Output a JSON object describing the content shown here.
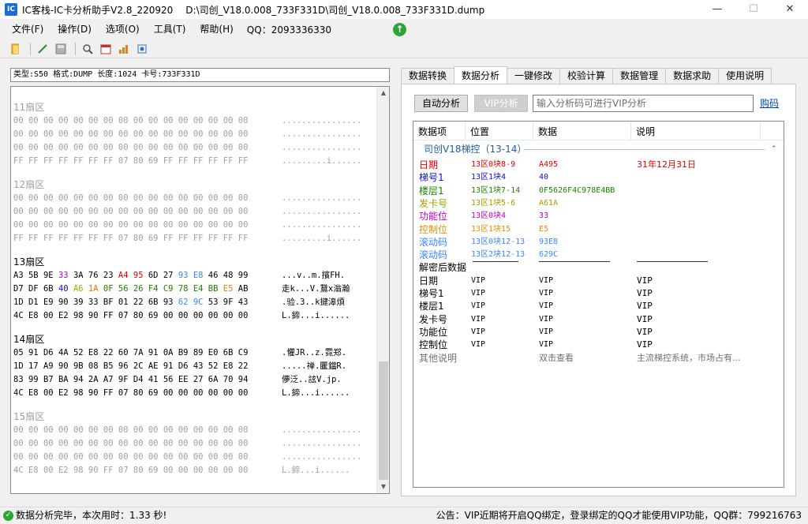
{
  "window": {
    "app_title": "IC客栈-IC卡分析助手V2.8_220920",
    "file_path": "D:\\司创_V18.0.008_733F331D\\司创_V18.0.008_733F331D.dump",
    "minimize": "—",
    "maximize": "☐",
    "close": "✕"
  },
  "menu": {
    "file": "文件(F)",
    "operate": "操作(D)",
    "options": "选项(O)",
    "tools": "工具(T)",
    "help": "帮助(H)",
    "qq": "QQ：2093336330"
  },
  "left": {
    "info": "类型:S50 格式:DUMP 长度:1024 卡号:733F331D",
    "sectors": [
      {
        "title": "11扇区",
        "grey": true,
        "rows": [
          {
            "bytes": [
              "00",
              "00",
              "00",
              "00",
              "00",
              "00",
              "00",
              "00",
              "00",
              "00",
              "00",
              "00",
              "00",
              "00",
              "00",
              "00"
            ],
            "ascii": "................"
          },
          {
            "bytes": [
              "00",
              "00",
              "00",
              "00",
              "00",
              "00",
              "00",
              "00",
              "00",
              "00",
              "00",
              "00",
              "00",
              "00",
              "00",
              "00"
            ],
            "ascii": "................"
          },
          {
            "bytes": [
              "00",
              "00",
              "00",
              "00",
              "00",
              "00",
              "00",
              "00",
              "00",
              "00",
              "00",
              "00",
              "00",
              "00",
              "00",
              "00"
            ],
            "ascii": "................"
          },
          {
            "bytes": [
              "FF",
              "FF",
              "FF",
              "FF",
              "FF",
              "FF",
              "FF",
              "07",
              "80",
              "69",
              "FF",
              "FF",
              "FF",
              "FF",
              "FF",
              "FF"
            ],
            "ascii": ".........i......"
          }
        ]
      },
      {
        "title": "12扇区",
        "grey": true,
        "rows": [
          {
            "bytes": [
              "00",
              "00",
              "00",
              "00",
              "00",
              "00",
              "00",
              "00",
              "00",
              "00",
              "00",
              "00",
              "00",
              "00",
              "00",
              "00"
            ],
            "ascii": "................"
          },
          {
            "bytes": [
              "00",
              "00",
              "00",
              "00",
              "00",
              "00",
              "00",
              "00",
              "00",
              "00",
              "00",
              "00",
              "00",
              "00",
              "00",
              "00"
            ],
            "ascii": "................"
          },
          {
            "bytes": [
              "00",
              "00",
              "00",
              "00",
              "00",
              "00",
              "00",
              "00",
              "00",
              "00",
              "00",
              "00",
              "00",
              "00",
              "00",
              "00"
            ],
            "ascii": "................"
          },
          {
            "bytes": [
              "FF",
              "FF",
              "FF",
              "FF",
              "FF",
              "FF",
              "FF",
              "07",
              "80",
              "69",
              "FF",
              "FF",
              "FF",
              "FF",
              "FF",
              "FF"
            ],
            "ascii": ".........i......"
          }
        ]
      },
      {
        "title": "13扇区",
        "grey": false,
        "rows": [
          {
            "bytes": [
              "A3",
              "5B",
              "9E",
              "33",
              "3A",
              "76",
              "23",
              "A4",
              "95",
              "6D",
              "27",
              "93",
              "E8",
              "46",
              "48",
              "99"
            ],
            "colors": [
              "",
              "",
              "",
              "#c000c0",
              "",
              "",
              "",
              "#e00000",
              "#e00000",
              "",
              "",
              "#3a86ff",
              "#3a86ff",
              "",
              "",
              ""
            ],
            "ascii": "...v..m.擯FH."
          },
          {
            "bytes": [
              "D7",
              "DF",
              "6B",
              "40",
              "A6",
              "1A",
              "0F",
              "56",
              "26",
              "F4",
              "C9",
              "78",
              "E4",
              "BB",
              "E5",
              "AB"
            ],
            "colors": [
              "",
              "",
              "",
              "#1010d0",
              "#a8a800",
              "#e08000",
              "#208000",
              "#208000",
              "#208000",
              "#208000",
              "#208000",
              "#208000",
              "#208000",
              "#208000",
              "#e08000",
              ""
            ],
            "ascii": "走k...V.鵞x滃瀚"
          },
          {
            "bytes": [
              "1D",
              "D1",
              "E9",
              "90",
              "39",
              "33",
              "BF",
              "01",
              "22",
              "6B",
              "93",
              "62",
              "9C",
              "53",
              "9F",
              "43"
            ],
            "colors": [
              "",
              "",
              "",
              "",
              "",
              "",
              "",
              "",
              "",
              "",
              "",
              "#3a86ff",
              "#3a86ff",
              "",
              "",
              ""
            ],
            "ascii": ".验.3..k揵滜煩"
          },
          {
            "bytes": [
              "4C",
              "E8",
              "00",
              "E2",
              "98",
              "90",
              "FF",
              "07",
              "80",
              "69",
              "00",
              "00",
              "00",
              "00",
              "00",
              "00"
            ],
            "ascii": "L.鍗...i......"
          }
        ]
      },
      {
        "title": "14扇区",
        "grey": false,
        "rows": [
          {
            "bytes": [
              "05",
              "91",
              "D6",
              "4A",
              "52",
              "E8",
              "22",
              "60",
              "7A",
              "91",
              "0A",
              "B9",
              "89",
              "E0",
              "6B",
              "C9"
            ],
            "ascii": ".懼JR..z.霓郑."
          },
          {
            "bytes": [
              "1D",
              "17",
              "A9",
              "90",
              "9B",
              "08",
              "B5",
              "96",
              "2C",
              "AE",
              "91",
              "D6",
              "43",
              "52",
              "E8",
              "22"
            ],
            "ascii": ".....禅.匷鐺R."
          },
          {
            "bytes": [
              "83",
              "99",
              "B7",
              "BA",
              "94",
              "2A",
              "A7",
              "9F",
              "D4",
              "41",
              "56",
              "EE",
              "27",
              "6A",
              "70",
              "94"
            ],
            "ascii": "儚泛..詃V.jp."
          },
          {
            "bytes": [
              "4C",
              "E8",
              "00",
              "E2",
              "98",
              "90",
              "FF",
              "07",
              "80",
              "69",
              "00",
              "00",
              "00",
              "00",
              "00",
              "00"
            ],
            "ascii": "L.鍗...i......"
          }
        ]
      },
      {
        "title": "15扇区",
        "grey": true,
        "rows": [
          {
            "bytes": [
              "00",
              "00",
              "00",
              "00",
              "00",
              "00",
              "00",
              "00",
              "00",
              "00",
              "00",
              "00",
              "00",
              "00",
              "00",
              "00"
            ],
            "ascii": "................"
          },
          {
            "bytes": [
              "00",
              "00",
              "00",
              "00",
              "00",
              "00",
              "00",
              "00",
              "00",
              "00",
              "00",
              "00",
              "00",
              "00",
              "00",
              "00"
            ],
            "ascii": "................"
          },
          {
            "bytes": [
              "00",
              "00",
              "00",
              "00",
              "00",
              "00",
              "00",
              "00",
              "00",
              "00",
              "00",
              "00",
              "00",
              "00",
              "00",
              "00"
            ],
            "ascii": "................"
          },
          {
            "bytes": [
              "4C",
              "E8",
              "00",
              "E2",
              "98",
              "90",
              "FF",
              "07",
              "80",
              "69",
              "00",
              "00",
              "00",
              "00",
              "00",
              "00"
            ],
            "ascii": "L.鍗...i......"
          }
        ]
      }
    ]
  },
  "tabs": [
    "数据转换",
    "数据分析",
    "一键修改",
    "校验计算",
    "数据管理",
    "数据求助",
    "使用说明"
  ],
  "active_tab": 1,
  "analysis": {
    "auto_button": "自动分析",
    "vip_button": "VIP分析",
    "input_placeholder": "输入分析码可进行VIP分析",
    "buy_link": "购码",
    "columns": [
      "数据项",
      "位置",
      "数据",
      "说明"
    ],
    "group": "司创V18梯控（13-14）",
    "group_chevron": "⌃",
    "rows": [
      {
        "item": "日期",
        "pos": "13区0块8-9",
        "data": "A495",
        "desc": "31年12月31日",
        "color": "#e00000"
      },
      {
        "item": "梯号1",
        "pos": "13区1块4",
        "data": "40",
        "desc": "",
        "color": "#1010d0"
      },
      {
        "item": "楼层1",
        "pos": "13区1块7-14",
        "data": "0F5626F4C978E4BB",
        "desc": "",
        "color": "#208000"
      },
      {
        "item": "发卡号",
        "pos": "13区1块5-6",
        "data": "A61A",
        "desc": "",
        "color": "#a0a000"
      },
      {
        "item": "功能位",
        "pos": "13区0块4",
        "data": "33",
        "desc": "",
        "color": "#c000c0"
      },
      {
        "item": "控制位",
        "pos": "13区1块15",
        "data": "E5",
        "desc": "",
        "color": "#e89000"
      },
      {
        "item": "滚动码",
        "pos": "13区0块12-13",
        "data": "93E8",
        "desc": "",
        "color": "#3a86ff"
      },
      {
        "item": "滚动码",
        "pos": "13区2块12-13",
        "data": "629C",
        "desc": "",
        "color": "#3a86ff"
      }
    ],
    "decrypted_title": "解密后数据",
    "vip_rows": [
      {
        "item": "日期",
        "pos": "VIP",
        "data": "VIP",
        "desc": "VIP"
      },
      {
        "item": "梯号1",
        "pos": "VIP",
        "data": "VIP",
        "desc": "VIP"
      },
      {
        "item": "楼层1",
        "pos": "VIP",
        "data": "VIP",
        "desc": "VIP"
      },
      {
        "item": "发卡号",
        "pos": "VIP",
        "data": "VIP",
        "desc": "VIP"
      },
      {
        "item": "功能位",
        "pos": "VIP",
        "data": "VIP",
        "desc": "VIP"
      },
      {
        "item": "控制位",
        "pos": "VIP",
        "data": "VIP",
        "desc": "VIP"
      }
    ],
    "other": {
      "item": "其他说明",
      "data": "双击查看",
      "desc": "主流梯控系统，市场占有..."
    }
  },
  "status": {
    "ok_icon": "✓",
    "text": "数据分析完毕，本次用时：1.33 秒!",
    "notice": "公告：VIP近期将开启QQ绑定，登录绑定的QQ才能使用VIP功能，QQ群：799216763"
  }
}
